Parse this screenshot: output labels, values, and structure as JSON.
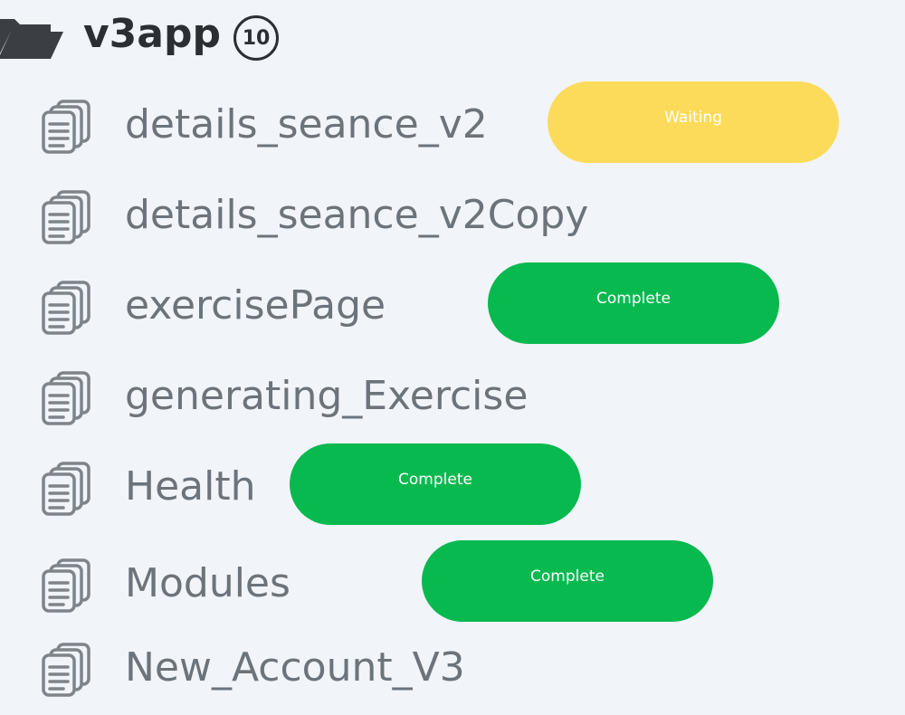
{
  "folder": {
    "name": "v3app",
    "count": "10",
    "icon": "folder-open-icon"
  },
  "items": [
    {
      "label": "details_seance_v2",
      "icon": "document-stack-icon",
      "status": "Waiting",
      "status_color": "#fddb5a"
    },
    {
      "label": "details_seance_v2Copy",
      "icon": "document-stack-icon"
    },
    {
      "label": "exercisePage",
      "icon": "document-stack-icon",
      "status": "Complete",
      "status_color": "#08b94f"
    },
    {
      "label": "generating_Exercise",
      "icon": "document-stack-icon"
    },
    {
      "label": "Health",
      "icon": "document-stack-icon",
      "status": "Complete",
      "status_color": "#08b94f"
    },
    {
      "label": "Modules",
      "icon": "document-stack-icon",
      "status": "Complete",
      "status_color": "#08b94f"
    },
    {
      "label": "New_Account_V3",
      "icon": "document-stack-icon"
    }
  ]
}
